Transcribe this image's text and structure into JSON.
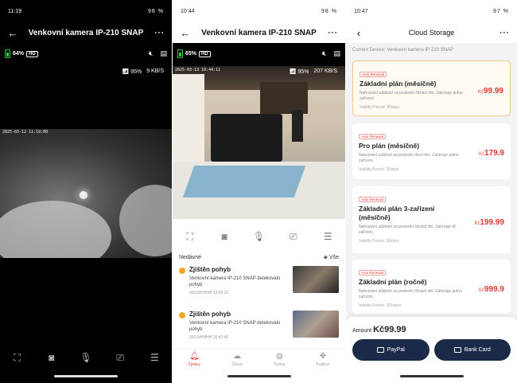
{
  "screen1": {
    "status": {
      "time": "11:19",
      "right": "96 %"
    },
    "header": {
      "title": "Venkovní kamera IP-210 SNAP"
    },
    "camera": {
      "battery": "64%",
      "quality": "HD",
      "wifi": "95%",
      "rate": "9 KB/S",
      "timestamp": "2025-03-12 11:19:00"
    }
  },
  "screen2": {
    "status": {
      "time": "10:44",
      "right": "98 %"
    },
    "header": {
      "title": "Venkovní kamera IP-210 SNAP"
    },
    "camera": {
      "battery": "65%",
      "quality": "HD",
      "wifi": "95%",
      "rate": "207 KB/S",
      "timestamp": "2025-03-13 10:44:11"
    },
    "list": {
      "title": "Nedávné",
      "all": "Vše",
      "events": [
        {
          "title": "Zjištěn pohyb",
          "desc": "Venkovní kamera IP-210 SNAP detekovalo pohyb",
          "time": "03/13/HHHH 10:43:13"
        },
        {
          "title": "Zjištěn pohyb",
          "desc": "Venkovní kamera IP-210 SNAP detekovalo pohyb",
          "time": "03/13/HHHH 10:42:46"
        }
      ]
    },
    "tabs": [
      "Zprávy",
      "Cloud",
      "Scény",
      "Funkce"
    ]
  },
  "screen3": {
    "status": {
      "time": "10:47",
      "right": "97 %"
    },
    "header": {
      "title": "Cloud Storage"
    },
    "device": "Current Device: Venkovní kamera IP-210 SNAP",
    "auto_label": "Auto Renewal",
    "currency": "Kč",
    "plans": [
      {
        "name": "Základní plán (měsíčně)",
        "desc": "Nahrávání událostí za poslední čtrnáct dní. Zahrnuje jedno zařízení.",
        "valid": "Validity Period: 30days",
        "price": "99.99"
      },
      {
        "name": "Pro plán (měsíčně)",
        "desc": "Nahrávání událostí za poslední třicet dní. Zahrnuje jedno zařízení.",
        "valid": "Validity Period: 30days",
        "price": "179.9"
      },
      {
        "name": "Základní plán 3-zařízení (měsíčně)",
        "desc": "Nahrávání událostí za poslední čtrnáct dní. Zahrnuje tři zařízení.",
        "valid": "Validity Period: 30days",
        "price": "199.99"
      },
      {
        "name": "Základní plán (ročně)",
        "desc": "Nahrávání událostí za poslední čtrnáct dní. Zahrnuje jedno zařízení.",
        "valid": "Validity Period: 365days",
        "price": "999.9"
      }
    ],
    "amount_label": "Amount",
    "amount_value": "Kč99.99",
    "paypal": "PayPal",
    "bankcard": "Bank Card"
  }
}
